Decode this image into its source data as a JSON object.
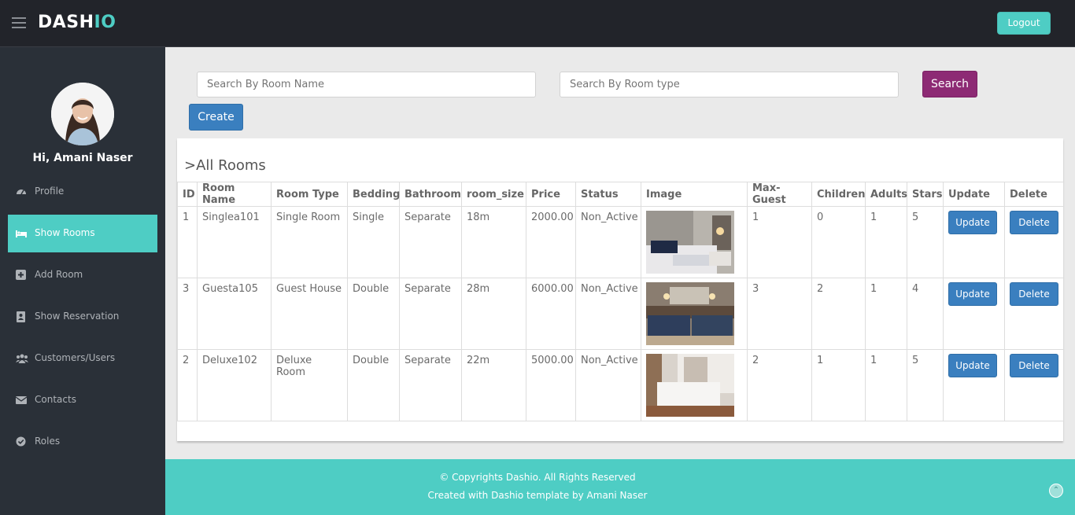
{
  "brand": {
    "prefix": "DASH",
    "accent": "IO"
  },
  "header": {
    "logout_label": "Logout"
  },
  "user": {
    "greeting": "Hi, Amani Naser"
  },
  "sidebar": {
    "items": [
      {
        "label": "Profile",
        "icon": "dashboard-icon",
        "active": false
      },
      {
        "label": "Show Rooms",
        "icon": "bed-icon",
        "active": true
      },
      {
        "label": "Add Room",
        "icon": "plus-square-icon",
        "active": false
      },
      {
        "label": "Show Reservation",
        "icon": "contact-book-icon",
        "active": false
      },
      {
        "label": "Customers/Users",
        "icon": "users-icon",
        "active": false
      },
      {
        "label": "Contacts",
        "icon": "envelope-icon",
        "active": false
      },
      {
        "label": "Roles",
        "icon": "check-circle-icon",
        "active": false
      }
    ]
  },
  "search": {
    "room_name_placeholder": "Search By Room Name",
    "room_type_placeholder": "Search By Room type",
    "search_label": "Search",
    "create_label": "Create"
  },
  "rooms_panel": {
    "title": ">All Rooms",
    "columns": [
      "ID",
      "Room Name",
      "Room Type",
      "Bedding",
      "Bathroom",
      "room_size",
      "Price",
      "Status",
      "Image",
      "Max-Guest",
      "Children",
      "Adults",
      "Stars",
      "Update",
      "Delete"
    ],
    "rows": [
      {
        "id": "1",
        "name": "Singlea101",
        "type": "Single Room",
        "bedding": "Single",
        "bathroom": "Separate",
        "size": "18m",
        "price": "2000.00",
        "status": "Non_Active",
        "max_guest": "1",
        "children": "0",
        "adults": "1",
        "stars": "5",
        "update_label": "Update",
        "delete_label": "Delete"
      },
      {
        "id": "3",
        "name": "Guesta105",
        "type": "Guest House",
        "bedding": "Double",
        "bathroom": "Separate",
        "size": "28m",
        "price": "6000.00",
        "status": "Non_Active",
        "max_guest": "3",
        "children": "2",
        "adults": "1",
        "stars": "4",
        "update_label": "Update",
        "delete_label": "Delete"
      },
      {
        "id": "2",
        "name": "Deluxe102",
        "type": "Deluxe Room",
        "bedding": "Double",
        "bathroom": "Separate",
        "size": "22m",
        "price": "5000.00",
        "status": "Non_Active",
        "max_guest": "2",
        "children": "1",
        "adults": "1",
        "stars": "5",
        "update_label": "Update",
        "delete_label": "Delete"
      }
    ]
  },
  "footer": {
    "copyright": "© Copyrights Dashio. All Rights Reserved",
    "credit": "Created with Dashio template by Amani Naser"
  },
  "colors": {
    "accent": "#4ecdc4",
    "sidebar": "#2a3038",
    "topbar": "#22242a",
    "search_button": "#8d2a74",
    "primary_button": "#3a7fbf"
  }
}
